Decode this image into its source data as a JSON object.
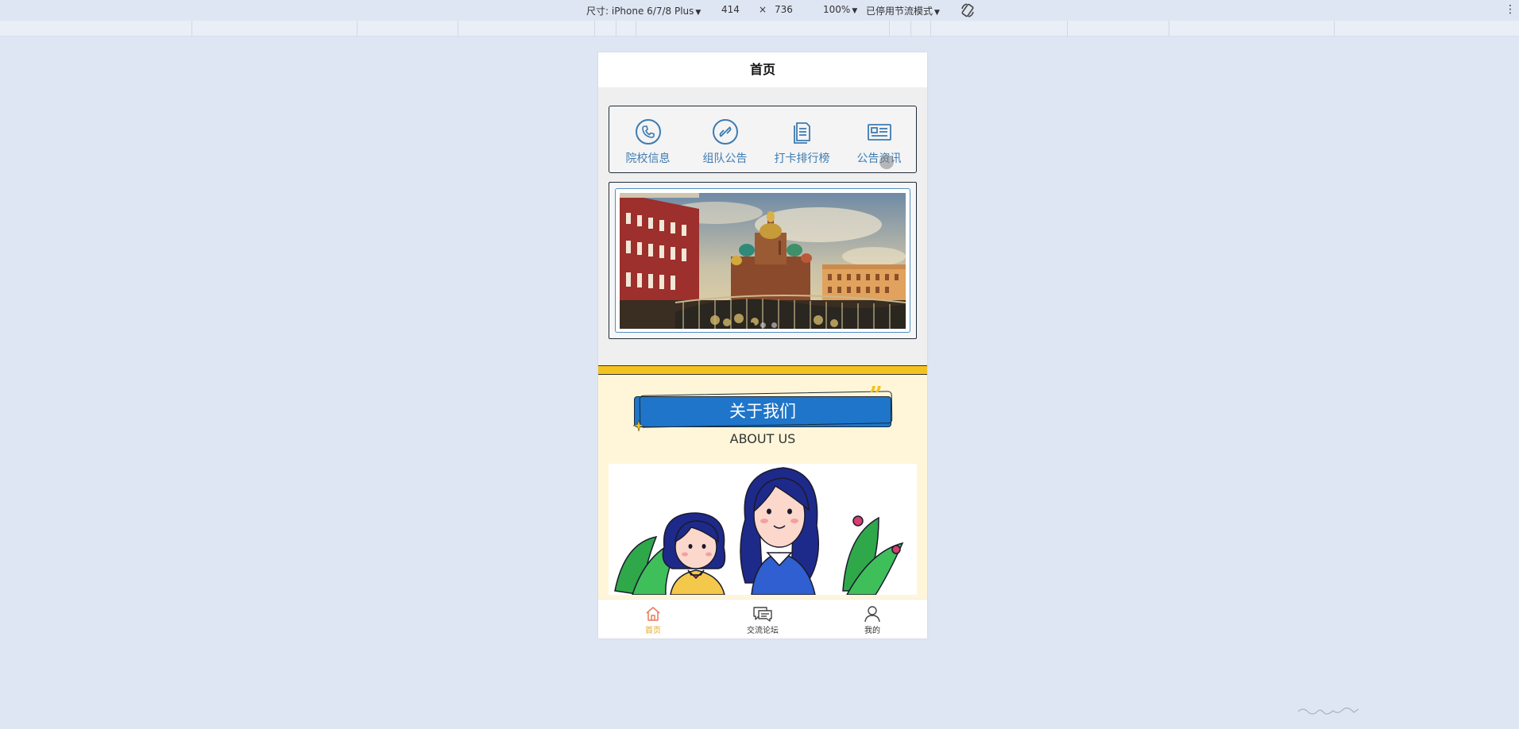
{
  "devtools": {
    "device_label": "尺寸: iPhone 6/7/8 Plus",
    "width": "414",
    "times": "×",
    "height": "736",
    "zoom": "100%",
    "throttle": "已停用节流模式",
    "rotate_icon": "rotate-icon",
    "more_icon": "kebab-icon"
  },
  "header": {
    "title": "首页"
  },
  "menu": {
    "items": [
      {
        "label": "院校信息",
        "icon": "phone-icon"
      },
      {
        "label": "组队公告",
        "icon": "link-icon"
      },
      {
        "label": "打卡排行榜",
        "icon": "document-icon"
      },
      {
        "label": "公告资讯",
        "icon": "news-icon"
      }
    ]
  },
  "banner": {
    "slide_count": 3,
    "active_index": 0
  },
  "about": {
    "title": "关于我们",
    "subtitle": "ABOUT US"
  },
  "tabbar": {
    "items": [
      {
        "label": "首页",
        "icon": "home-icon"
      },
      {
        "label": "交流论坛",
        "icon": "chat-icon"
      },
      {
        "label": "我的",
        "icon": "user-icon"
      }
    ]
  },
  "colors": {
    "accent_blue": "#3d7bb1",
    "about_yellow": "#f4c21f",
    "about_bg": "#fff6d9",
    "title_blue": "#1f75c9",
    "tab_active": "#e3a92a"
  }
}
